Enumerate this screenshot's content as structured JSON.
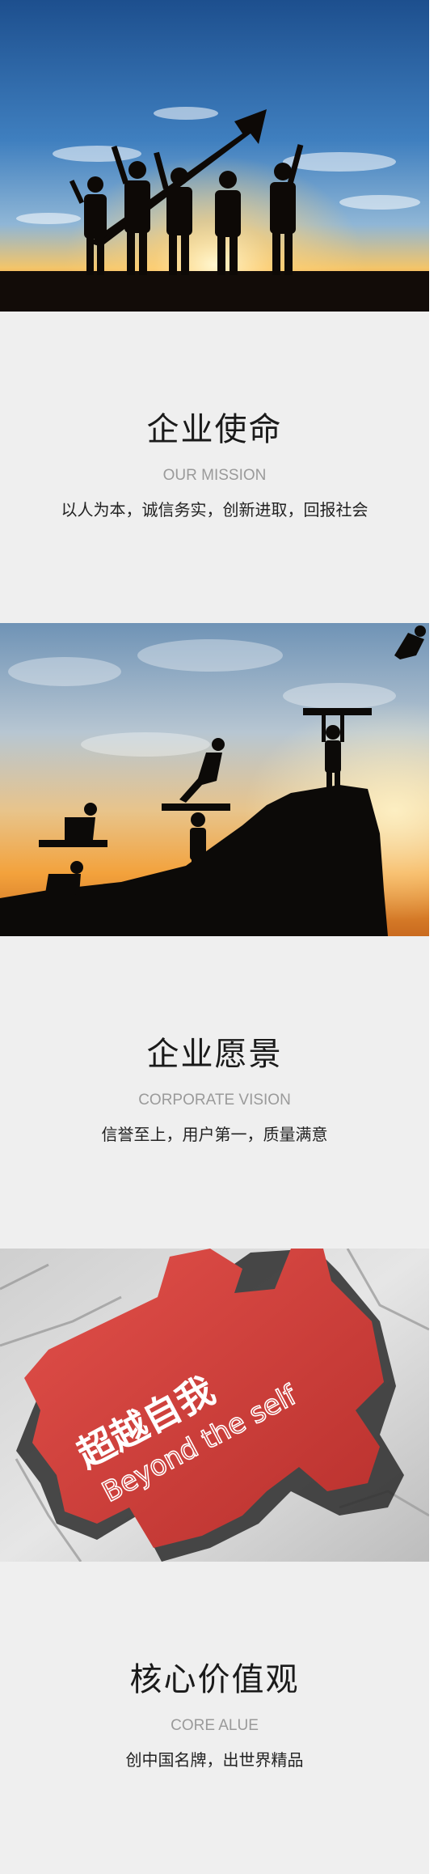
{
  "sections": [
    {
      "title": "企业使命",
      "subtitle": "OUR MISSION",
      "desc": "以人为本，诚信务实，创新进取，回报社会"
    },
    {
      "title": "企业愿景",
      "subtitle": "CORPORATE VISION",
      "desc": "信誉至上，用户第一，质量满意"
    },
    {
      "title": "核心价值观",
      "subtitle": "CORE ALUE",
      "desc": "创中国名牌，出世界精品"
    }
  ],
  "puzzle": {
    "cn_text": "超越自我",
    "en_text": "Beyond the self"
  },
  "colors": {
    "background": "#efefef",
    "puzzle_red": "#d9403d",
    "title": "#1a1a1a",
    "subtitle": "#9a9a9a"
  }
}
